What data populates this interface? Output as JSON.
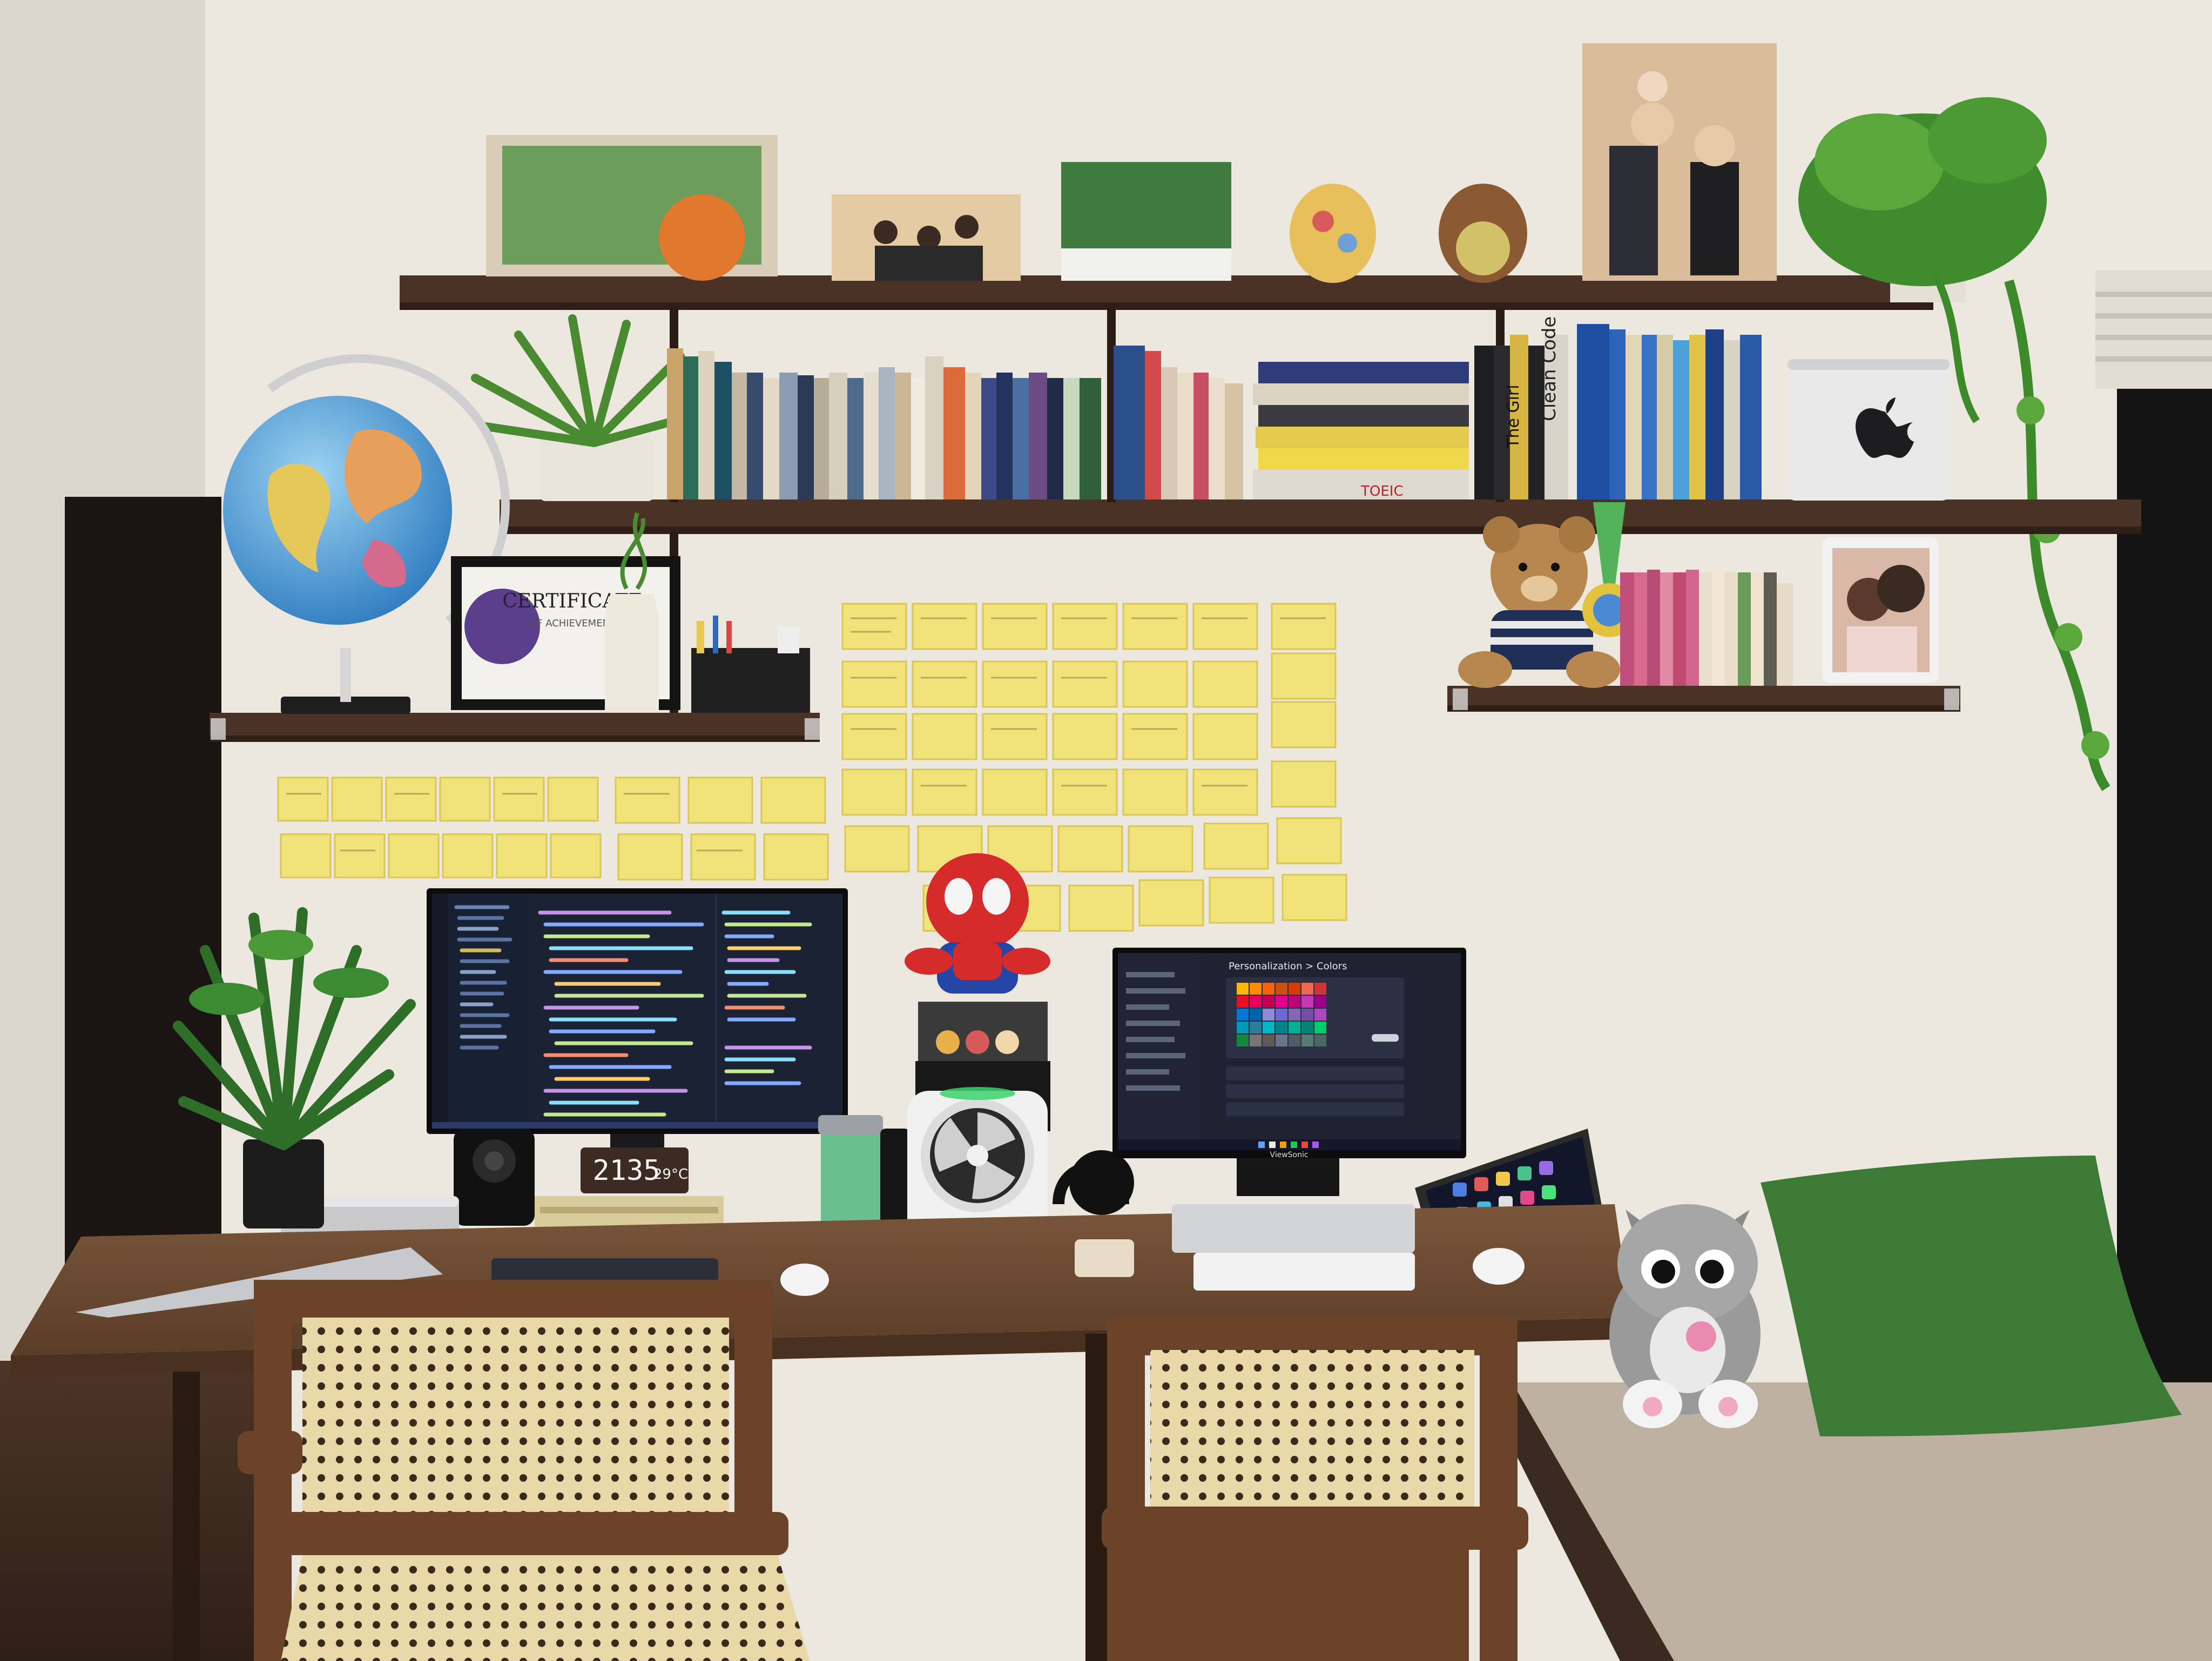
{
  "scene": {
    "colors": {
      "wall": "#ece8e0",
      "shelf": "#4a3326",
      "desk": "#6b4a32",
      "sticky": "#f2e27a",
      "screen_bg": "#1b2233",
      "pillow": "#3d7a35",
      "bench": "#bdb2a2"
    }
  },
  "visible_text": {
    "clock_time": "2135",
    "clock_temp": "29°C",
    "certificate_title": "CERTIFICATE",
    "certificate_sub": "OF ACHIEVEMENT",
    "book_spine_1": "Clean Code",
    "book_spine_2": "TOEIC",
    "book_spine_3": "The Girl",
    "settings_title": "Personalization > Colors",
    "monitor_brand": "ViewSonic"
  },
  "icons": [
    "apple-logo-icon",
    "spiderman-plush-icon",
    "teddy-bear-icon",
    "cat-plush-icon",
    "globe-icon",
    "fan-icon"
  ]
}
